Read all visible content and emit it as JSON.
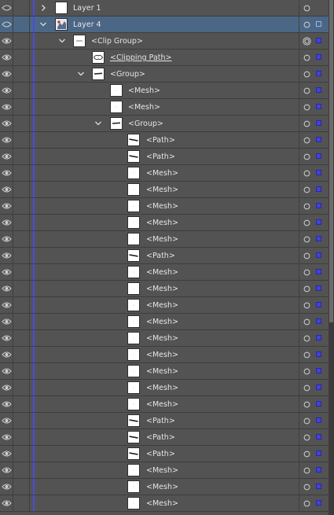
{
  "colors": {
    "panel_bg": "#535353",
    "selected_row_bg": "#4c6785",
    "layer_color_bar": "#4a4ae6",
    "selection_square": "#4343d6"
  },
  "rows": [
    {
      "label": "Layer 1",
      "depth": 0,
      "expander": "collapsed",
      "thumb": "blank",
      "eye": "outline",
      "selected": false,
      "target": "ring",
      "sel_box": "none"
    },
    {
      "label": "Layer 4",
      "depth": 0,
      "expander": "expanded",
      "thumb": "photo",
      "eye": "outline",
      "selected": true,
      "target": "ring",
      "sel_box": "hollow"
    },
    {
      "label": "<Clip Group>",
      "depth": 1,
      "expander": "expanded",
      "thumb": "dash",
      "eye": "filled",
      "selected": false,
      "target": "double-ring",
      "sel_box": "filled"
    },
    {
      "label": "<Clipping Path>",
      "depth": 2,
      "expander": "none",
      "thumb": "clip",
      "eye": "filled",
      "selected": false,
      "target": "ring",
      "sel_box": "filled",
      "underline": true
    },
    {
      "label": "<Group>",
      "depth": 2,
      "expander": "expanded",
      "thumb": "stroke",
      "eye": "filled",
      "selected": false,
      "target": "ring",
      "sel_box": "filled"
    },
    {
      "label": "<Mesh>",
      "depth": 3,
      "expander": "none",
      "thumb": "mesh",
      "eye": "filled",
      "selected": false,
      "target": "ring",
      "sel_box": "filled"
    },
    {
      "label": "<Mesh>",
      "depth": 3,
      "expander": "none",
      "thumb": "mesh",
      "eye": "filled",
      "selected": false,
      "target": "ring",
      "sel_box": "filled"
    },
    {
      "label": "<Group>",
      "depth": 3,
      "expander": "expanded",
      "thumb": "stroke",
      "eye": "filled",
      "selected": false,
      "target": "ring",
      "sel_box": "filled"
    },
    {
      "label": "<Path>",
      "depth": 4,
      "expander": "none",
      "thumb": "path",
      "eye": "filled",
      "selected": false,
      "target": "ring",
      "sel_box": "filled"
    },
    {
      "label": "<Path>",
      "depth": 4,
      "expander": "none",
      "thumb": "path",
      "eye": "filled",
      "selected": false,
      "target": "ring",
      "sel_box": "filled"
    },
    {
      "label": "<Mesh>",
      "depth": 4,
      "expander": "none",
      "thumb": "mesh",
      "eye": "filled",
      "selected": false,
      "target": "ring",
      "sel_box": "filled"
    },
    {
      "label": "<Mesh>",
      "depth": 4,
      "expander": "none",
      "thumb": "mesh",
      "eye": "filled",
      "selected": false,
      "target": "ring",
      "sel_box": "filled"
    },
    {
      "label": "<Mesh>",
      "depth": 4,
      "expander": "none",
      "thumb": "mesh",
      "eye": "filled",
      "selected": false,
      "target": "ring",
      "sel_box": "filled"
    },
    {
      "label": "<Mesh>",
      "depth": 4,
      "expander": "none",
      "thumb": "mesh",
      "eye": "filled",
      "selected": false,
      "target": "ring",
      "sel_box": "filled"
    },
    {
      "label": "<Mesh>",
      "depth": 4,
      "expander": "none",
      "thumb": "mesh",
      "eye": "filled",
      "selected": false,
      "target": "ring",
      "sel_box": "filled"
    },
    {
      "label": "<Path>",
      "depth": 4,
      "expander": "none",
      "thumb": "path",
      "eye": "filled",
      "selected": false,
      "target": "ring",
      "sel_box": "filled"
    },
    {
      "label": "<Mesh>",
      "depth": 4,
      "expander": "none",
      "thumb": "mesh",
      "eye": "filled",
      "selected": false,
      "target": "ring",
      "sel_box": "filled"
    },
    {
      "label": "<Mesh>",
      "depth": 4,
      "expander": "none",
      "thumb": "mesh",
      "eye": "filled",
      "selected": false,
      "target": "ring",
      "sel_box": "filled"
    },
    {
      "label": "<Mesh>",
      "depth": 4,
      "expander": "none",
      "thumb": "mesh",
      "eye": "filled",
      "selected": false,
      "target": "ring",
      "sel_box": "filled"
    },
    {
      "label": "<Mesh>",
      "depth": 4,
      "expander": "none",
      "thumb": "mesh",
      "eye": "filled",
      "selected": false,
      "target": "ring",
      "sel_box": "filled"
    },
    {
      "label": "<Mesh>",
      "depth": 4,
      "expander": "none",
      "thumb": "mesh",
      "eye": "filled",
      "selected": false,
      "target": "ring",
      "sel_box": "filled"
    },
    {
      "label": "<Mesh>",
      "depth": 4,
      "expander": "none",
      "thumb": "mesh",
      "eye": "filled",
      "selected": false,
      "target": "ring",
      "sel_box": "filled"
    },
    {
      "label": "<Mesh>",
      "depth": 4,
      "expander": "none",
      "thumb": "mesh",
      "eye": "filled",
      "selected": false,
      "target": "ring",
      "sel_box": "filled"
    },
    {
      "label": "<Mesh>",
      "depth": 4,
      "expander": "none",
      "thumb": "mesh",
      "eye": "filled",
      "selected": false,
      "target": "ring",
      "sel_box": "filled"
    },
    {
      "label": "<Mesh>",
      "depth": 4,
      "expander": "none",
      "thumb": "mesh",
      "eye": "filled",
      "selected": false,
      "target": "ring",
      "sel_box": "filled"
    },
    {
      "label": "<Path>",
      "depth": 4,
      "expander": "none",
      "thumb": "path",
      "eye": "filled",
      "selected": false,
      "target": "ring",
      "sel_box": "filled"
    },
    {
      "label": "<Path>",
      "depth": 4,
      "expander": "none",
      "thumb": "path",
      "eye": "filled",
      "selected": false,
      "target": "ring",
      "sel_box": "filled"
    },
    {
      "label": "<Path>",
      "depth": 4,
      "expander": "none",
      "thumb": "path",
      "eye": "filled",
      "selected": false,
      "target": "ring",
      "sel_box": "filled"
    },
    {
      "label": "<Mesh>",
      "depth": 4,
      "expander": "none",
      "thumb": "mesh",
      "eye": "filled",
      "selected": false,
      "target": "ring",
      "sel_box": "filled"
    },
    {
      "label": "<Mesh>",
      "depth": 4,
      "expander": "none",
      "thumb": "mesh",
      "eye": "filled",
      "selected": false,
      "target": "ring",
      "sel_box": "filled"
    },
    {
      "label": "<Mesh>",
      "depth": 4,
      "expander": "none",
      "thumb": "mesh",
      "eye": "filled",
      "selected": false,
      "target": "ring",
      "sel_box": "filled"
    }
  ]
}
